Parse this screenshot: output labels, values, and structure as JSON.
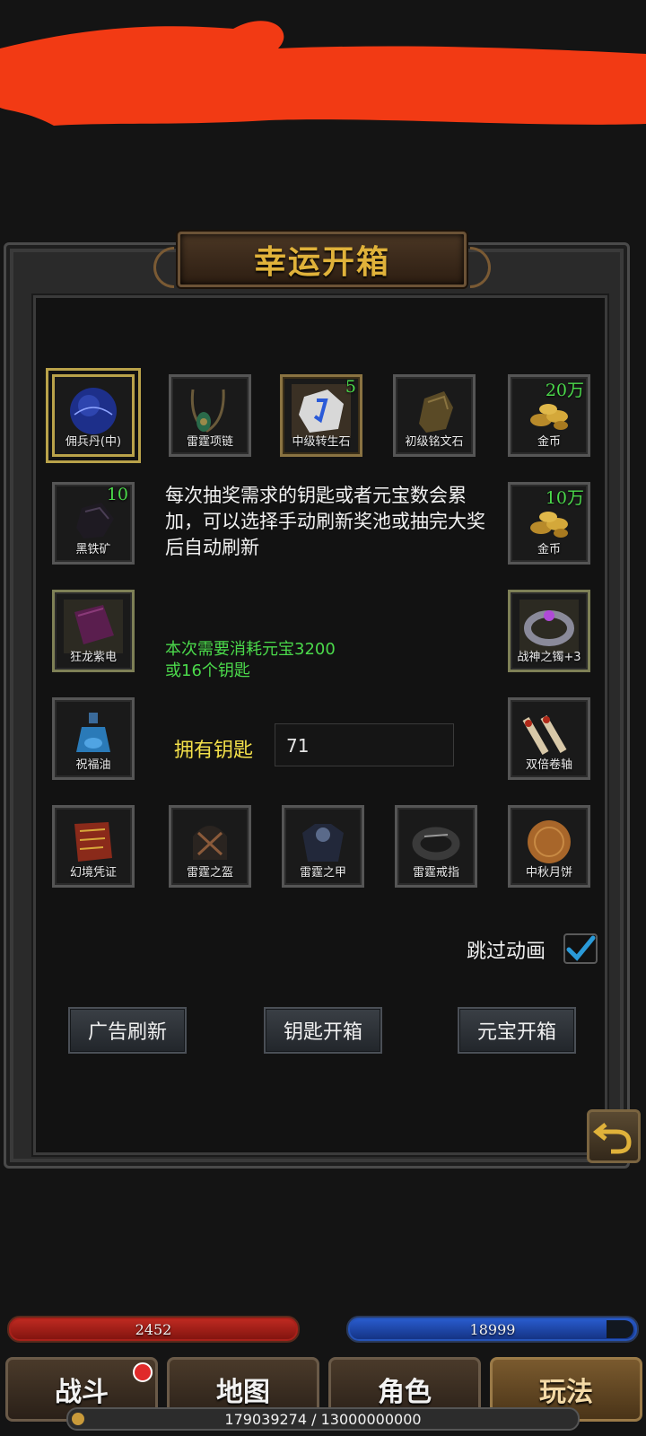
{
  "title": "幸运开箱",
  "items": [
    {
      "label": "佣兵丹(中)",
      "count": "",
      "selected": true,
      "icon": "mercenary-pill-icon"
    },
    {
      "label": "雷霆项链",
      "count": "",
      "icon": "thunder-necklace-icon"
    },
    {
      "label": "中级转生石",
      "count": "5",
      "icon": "rebirth-stone-icon"
    },
    {
      "label": "初级铭文石",
      "count": "",
      "icon": "inscription-stone-icon"
    },
    {
      "label": "金币",
      "count": "20万",
      "icon": "gold-coins-icon"
    },
    {
      "label": "黑铁矿",
      "count": "10",
      "icon": "black-iron-ore-icon"
    },
    {
      "label": "金币",
      "count": "10万",
      "icon": "gold-coins-icon"
    },
    {
      "label": "狂龙紫电",
      "count": "",
      "icon": "purple-book-icon"
    },
    {
      "label": "战神之镯+3",
      "count": "",
      "icon": "war-god-bracelet-icon"
    },
    {
      "label": "祝福油",
      "count": "",
      "icon": "blessing-oil-icon"
    },
    {
      "label": "双倍卷轴",
      "count": "",
      "icon": "double-scroll-icon"
    },
    {
      "label": "幻境凭证",
      "count": "",
      "icon": "illusion-voucher-icon"
    },
    {
      "label": "雷霆之盔",
      "count": "",
      "icon": "thunder-helmet-icon"
    },
    {
      "label": "雷霆之甲",
      "count": "",
      "icon": "thunder-armor-icon"
    },
    {
      "label": "雷霆戒指",
      "count": "",
      "icon": "thunder-ring-icon"
    },
    {
      "label": "中秋月饼",
      "count": "",
      "icon": "mooncake-icon"
    }
  ],
  "info": "每次抽奖需求的钥匙或者元宝数会累加，可以选择手动刷新奖池或抽完大奖后自动刷新",
  "cost": {
    "line1": "本次需要消耗元宝3200",
    "line2": "或16个钥匙"
  },
  "keys": {
    "label": "拥有钥匙",
    "value": "71"
  },
  "skip_animation": {
    "label": "跳过动画",
    "checked": true
  },
  "buttons": {
    "ad_refresh": "广告刷新",
    "key_open": "钥匙开箱",
    "ingot_open": "元宝开箱"
  },
  "hud": {
    "hp": "2452",
    "mp": "18999",
    "xp": "179039274 / 13000000000"
  },
  "tabs": {
    "battle": "战斗",
    "map": "地图",
    "character": "角色",
    "gameplay": "玩法"
  },
  "colors": {
    "accent_green": "#4bd94b",
    "title_gold": "#e0b23a",
    "key_yellow": "#f3e04a",
    "redaction": "#f23a14"
  }
}
